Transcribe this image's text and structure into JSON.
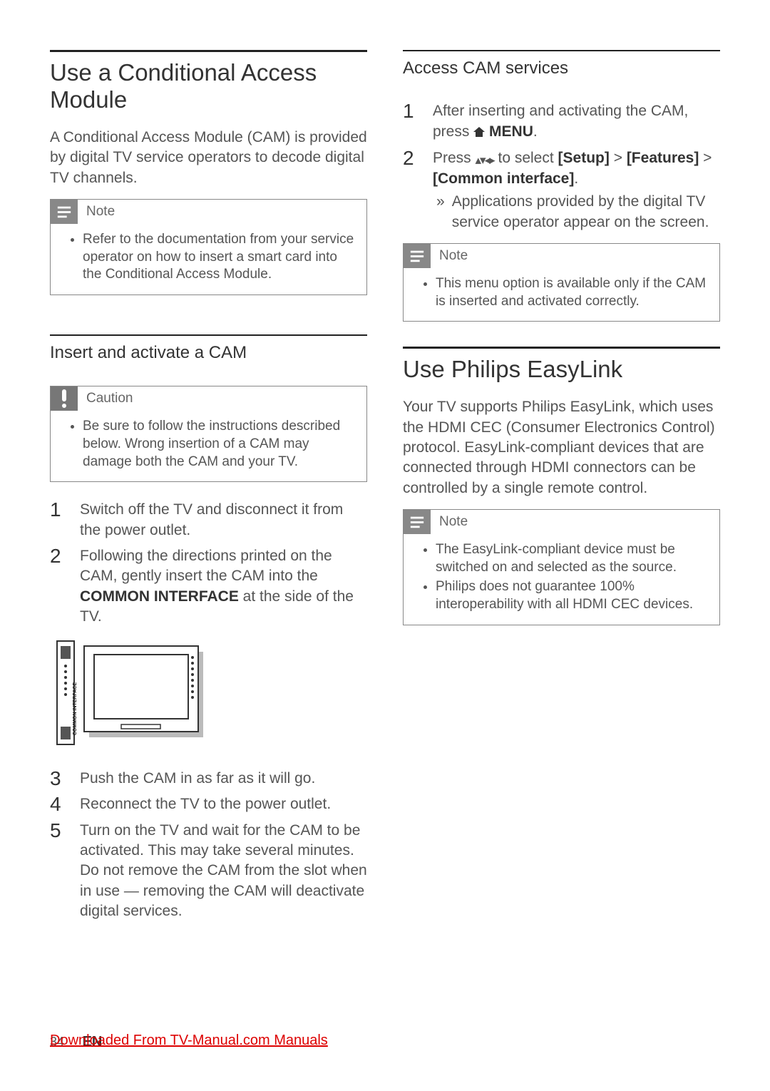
{
  "left": {
    "h2": "Use a Conditional Access Module",
    "intro": "A Conditional Access Module (CAM) is provided by digital TV service operators to decode digital TV channels.",
    "note_label": "Note",
    "note_items": [
      "Refer to the documentation from your service operator on how to insert a smart card into the Conditional Access Module."
    ],
    "h3": "Insert and activate a CAM",
    "caution_label": "Caution",
    "caution_items": [
      "Be sure to follow the instructions described below. Wrong insertion of a CAM may damage both the CAM and your TV."
    ],
    "steps_a": [
      {
        "n": "1",
        "text": "Switch off the TV and disconnect it from the power outlet."
      },
      {
        "n": "2",
        "pre": "Following the directions printed on the CAM, gently insert the CAM into the ",
        "strong": "COMMON INTERFACE",
        "post": " at the side of the TV."
      }
    ],
    "diagram_label": "COMMON INTERFACE",
    "steps_b": [
      {
        "n": "3",
        "text": "Push the CAM in as far as it will go."
      },
      {
        "n": "4",
        "text": "Reconnect the TV to the power outlet."
      },
      {
        "n": "5",
        "text": "Turn on the TV and wait for the CAM to be activated. This may take several minutes. Do not remove the CAM from the slot when in use — removing the CAM will deactivate digital services."
      }
    ]
  },
  "right": {
    "h3a": "Access CAM services",
    "steps": [
      {
        "n": "1",
        "pre": "After inserting and activating the CAM, press ",
        "icon": "home",
        "strong": " MENU",
        "post": "."
      },
      {
        "n": "2",
        "pre": "Press ",
        "icon": "arrows",
        "mid": " to select ",
        "s1": "[Setup]",
        "sep1": " > ",
        "s2": "[Features]",
        "sep2": " > ",
        "s3": "[Common interface]",
        "post": ".",
        "result_marker": "»",
        "result": "Applications provided by the digital TV service operator appear on the screen."
      }
    ],
    "note_label": "Note",
    "note_items": [
      "This menu option is available only if the CAM is inserted and activated correctly."
    ],
    "h2": "Use Philips EasyLink",
    "intro": "Your TV supports Philips EasyLink, which uses the HDMI CEC (Consumer Electronics Control) protocol. EasyLink-compliant devices that are connected through HDMI connectors can be controlled by a single remote control.",
    "note2_label": "Note",
    "note2_items": [
      "The EasyLink-compliant device must be switched on and selected as the source.",
      "Philips does not guarantee 100% interoperability with all HDMI CEC devices."
    ]
  },
  "footer": {
    "page": "34",
    "lang": "EN",
    "link_text": "Downloaded From TV-Manual.com Manuals"
  }
}
